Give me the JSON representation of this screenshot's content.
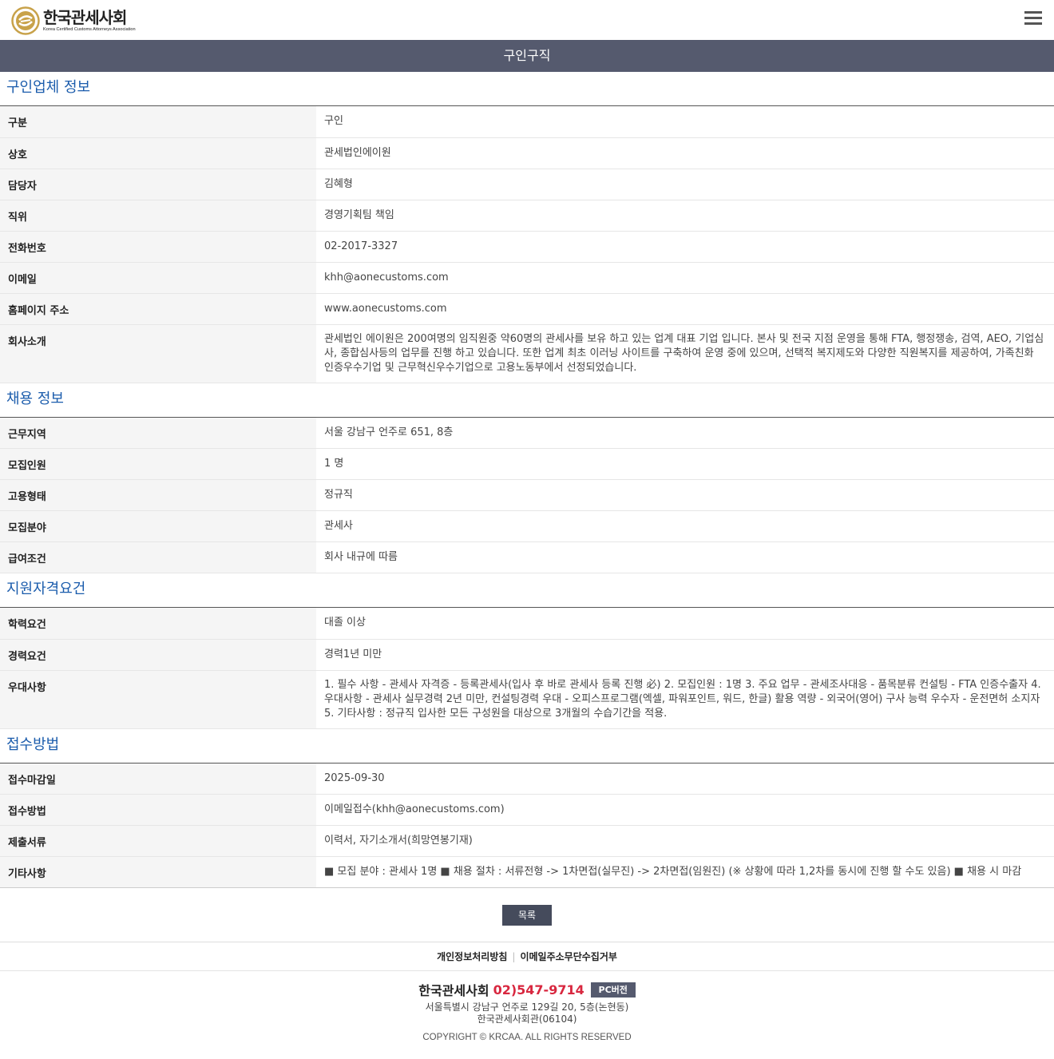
{
  "header": {
    "logo_ko": "한국관세사회",
    "logo_en": "Korea Certified Customs Attorneys Association",
    "menu_icon": "hamburger-menu-icon"
  },
  "page_title": "구인구직",
  "sections": {
    "company": {
      "title": "구인업체 정보",
      "rows": [
        {
          "label": "구분",
          "value": "구인"
        },
        {
          "label": "상호",
          "value": "관세법인에이원"
        },
        {
          "label": "담당자",
          "value": "김혜형"
        },
        {
          "label": "직위",
          "value": "경영기획팀 책임"
        },
        {
          "label": "전화번호",
          "value": "02-2017-3327"
        },
        {
          "label": "이메일",
          "value": "khh@aonecustoms.com"
        },
        {
          "label": "홈페이지 주소",
          "value": "www.aonecustoms.com"
        },
        {
          "label": "회사소개",
          "value": "관세법인 에이원은 200여명의 임직원중 약60명의 관세사를 보유 하고 있는 업계 대표 기업 입니다. 본사 및 전국 지점 운영을 통해 FTA, 행정쟁송, 검역, AEO, 기업심사, 종합심사등의 업무를 진행 하고 있습니다. 또한 업계 최초 이러닝 사이트를 구축하여 운영 중에 있으며, 선택적 복지제도와 다양한 직원복지를 제공하여, 가족친화 인증우수기업 및 근무혁신우수기업으로 고용노동부에서 선정되었습니다."
        }
      ]
    },
    "recruit": {
      "title": "채용 정보",
      "rows": [
        {
          "label": "근무지역",
          "value": "서울 강남구 언주로 651, 8층"
        },
        {
          "label": "모집인원",
          "value": "1 명"
        },
        {
          "label": "고용형태",
          "value": "정규직"
        },
        {
          "label": "모집분야",
          "value": "관세사"
        },
        {
          "label": "급여조건",
          "value": "회사 내규에 따름"
        }
      ]
    },
    "qualification": {
      "title": "지원자격요건",
      "rows": [
        {
          "label": "학력요건",
          "value": "대졸 이상"
        },
        {
          "label": "경력요건",
          "value": "경력1년 미만"
        },
        {
          "label": "우대사항",
          "value": "1. 필수 사항 - 관세사 자격증 - 등록관세사(입사 후 바로 관세사 등록 진행 必) 2. 모집인원 : 1명 3. 주요 업무 - 관세조사대응 - 품목분류 컨설팅 - FTA 인증수출자 4. 우대사항 - 관세사 실무경력 2년 미만, 컨설팅경력 우대 - 오피스프로그램(엑셀, 파워포인트, 워드, 한글) 활용 역량 - 외국어(영어) 구사 능력 우수자 - 운전면허 소지자 5. 기타사항 : 정규직 입사한 모든 구성원을 대상으로 3개월의 수습기간을 적용."
        }
      ]
    },
    "apply": {
      "title": "접수방법",
      "rows": [
        {
          "label": "접수마감일",
          "value": "2025-09-30"
        },
        {
          "label": "접수방법",
          "value": "이메일접수(khh@aonecustoms.com)"
        },
        {
          "label": "제출서류",
          "value": "이력서, 자기소개서(희망연봉기재)"
        },
        {
          "label": "기타사항",
          "value": "■ 모집 분야 : 관세사 1명 ■ 채용 절차 : 서류전형 -> 1차면접(실무진) -> 2차면접(임원진) (※ 상황에 따라 1,2차를 동시에 진행 할 수도 있음) ■ 채용 시 마감"
        }
      ]
    }
  },
  "list_button": "목록",
  "footer": {
    "links": [
      "개인정보처리방침",
      "이메일주소무단수집거부"
    ],
    "org_name": "한국관세사회",
    "phone": "02)547-9714",
    "pc_button": "PC버전",
    "address1": "서울특별시 강남구 언주로 129길 20, 5층(논현동)",
    "address2": "한국관세사회관(06104)",
    "copyright": "COPYRIGHT © KRCAA. ALL RIGHTS RESERVED"
  },
  "colors": {
    "title_bar": "#555a6e",
    "section_title": "#1b5cac",
    "phone": "#d8273f",
    "logo_gold": "#c8a24a"
  }
}
